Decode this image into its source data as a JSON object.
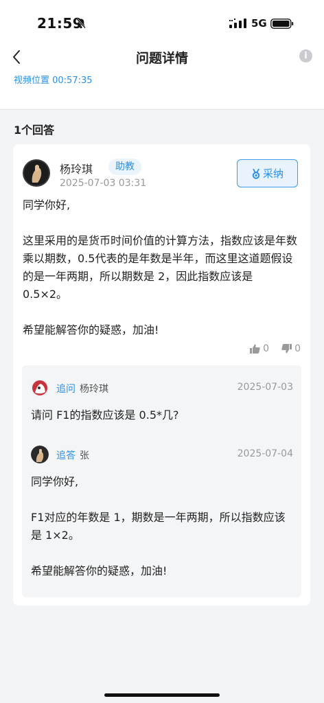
{
  "status": {
    "time": "21:59",
    "network": "5G"
  },
  "nav": {
    "title": "问题详情",
    "info_glyph": "i"
  },
  "video": {
    "position_label": "视频位置 00:57:35"
  },
  "answers_count_label": "1个回答",
  "answer": {
    "author": "杨玲琪",
    "role": "助教",
    "time": "2025-07-03 03:31",
    "adopt_label": "采纳",
    "body": [
      "同学你好,",
      "这里采用的是货币时间价值的计算方法，指数应该是年数乘以期数，0.5代表的是年数是半年，而这里这道题假设的是一年两期，所以期数是 2，因此指数应该是 0.5×2。",
      "希望能解答你的疑惑，加油!"
    ],
    "likes": "0",
    "dislikes": "0"
  },
  "followups": [
    {
      "kind": "追问",
      "name": "杨玲琪",
      "date": "2025-07-03",
      "body": [
        "请问 F1的指数应该是 0.5*几?"
      ]
    },
    {
      "kind": "追答",
      "name": "张",
      "date": "2025-07-04",
      "body": [
        "同学你好,",
        "F1对应的年数是 1，期数是一年两期，所以指数应该是 1×2。",
        "希望能解答你的疑惑，加油!"
      ]
    }
  ],
  "colors": {
    "accent": "#2b8fe6",
    "background": "#f3f4f6"
  },
  "icons": [
    "bell-slash-icon",
    "signal-icon",
    "battery-icon",
    "back-icon",
    "info-icon",
    "medal-icon",
    "thumb-up-icon",
    "thumb-down-icon"
  ]
}
